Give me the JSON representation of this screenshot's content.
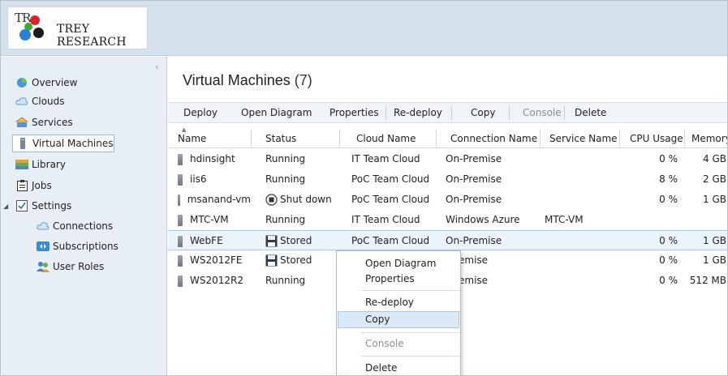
{
  "header": {
    "logo_mark": "TR",
    "logo_text": "TREY RESEARCH"
  },
  "sidebar": {
    "items": [
      {
        "label": "Overview",
        "icon": "overview-icon"
      },
      {
        "label": "Clouds",
        "icon": "cloud-icon"
      },
      {
        "label": "Services",
        "icon": "services-icon"
      },
      {
        "label": "Virtual Machines",
        "icon": "vm-icon",
        "selected": true
      },
      {
        "label": "Library",
        "icon": "library-icon"
      },
      {
        "label": "Jobs",
        "icon": "jobs-icon"
      },
      {
        "label": "Settings",
        "icon": "settings-icon",
        "expanded": true
      },
      {
        "label": "Connections",
        "icon": "cloud-icon"
      },
      {
        "label": "Subscriptions",
        "icon": "subscriptions-icon"
      },
      {
        "label": "User Roles",
        "icon": "user-roles-icon"
      }
    ]
  },
  "main": {
    "title": "Virtual Machines",
    "count": "(7)",
    "toolbar": {
      "deploy": "Deploy",
      "open_diagram": "Open Diagram",
      "properties": "Properties",
      "redeploy": "Re-deploy",
      "copy": "Copy",
      "console": "Console",
      "delete": "Delete"
    },
    "columns": {
      "name": "Name",
      "status": "Status",
      "cloud": "Cloud Name",
      "connection": "Connection Name",
      "service": "Service Name",
      "cpu": "CPU Usage",
      "memory": "Memory"
    },
    "rows": [
      {
        "name": "hdinsight",
        "status": "Running",
        "status_icon": "",
        "cloud": "IT Team Cloud",
        "connection": "On-Premise",
        "service": "",
        "cpu": "0 %",
        "memory": "4 GB"
      },
      {
        "name": "iis6",
        "status": "Running",
        "status_icon": "",
        "cloud": "PoC Team Cloud",
        "connection": "On-Premise",
        "service": "",
        "cpu": "8 %",
        "memory": "2 GB"
      },
      {
        "name": "msanand-vm",
        "status": "Shut down",
        "status_icon": "shutdown-icon",
        "cloud": "PoC Team Cloud",
        "connection": "On-Premise",
        "service": "",
        "cpu": "0 %",
        "memory": "1 GB"
      },
      {
        "name": "MTC-VM",
        "status": "Running",
        "status_icon": "",
        "cloud": "IT Team Cloud",
        "connection": "Windows Azure",
        "service": "MTC-VM",
        "cpu": "",
        "memory": ""
      },
      {
        "name": "WebFE",
        "status": "Stored",
        "status_icon": "stored-icon",
        "cloud": "PoC Team Cloud",
        "connection": "On-Premise",
        "service": "",
        "cpu": "0 %",
        "memory": "1 GB",
        "selected": true
      },
      {
        "name": "WS2012FE",
        "status": "Stored",
        "status_icon": "stored-icon",
        "cloud": "",
        "connection": "-Premise",
        "service": "",
        "cpu": "0 %",
        "memory": "1 GB"
      },
      {
        "name": "WS2012R2",
        "status": "Running",
        "status_icon": "",
        "cloud": "",
        "connection": "-Premise",
        "service": "",
        "cpu": "0 %",
        "memory": "512 MB"
      }
    ]
  },
  "context_menu": {
    "items": [
      {
        "label": "Open Diagram"
      },
      {
        "label": "Properties"
      },
      {
        "label": "Re-deploy"
      },
      {
        "label": "Copy",
        "hover": true
      },
      {
        "label": "Console",
        "disabled": true
      },
      {
        "label": "Delete"
      }
    ]
  },
  "colors": {
    "header_bg": "#d6e1ee",
    "sidebar_bg": "#e8eef6",
    "selection": "#a9c7ea"
  }
}
